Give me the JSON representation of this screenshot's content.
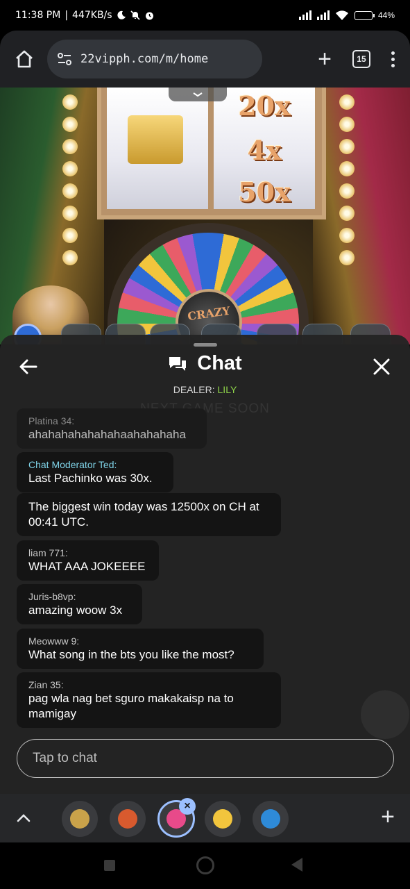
{
  "status_bar": {
    "time": "11:38 PM",
    "net_speed": "447KB/s",
    "battery": "44%",
    "battery_level": 0.44
  },
  "browser": {
    "url": "22vipph.com/m/home",
    "tab_count": "15"
  },
  "game": {
    "multipliers": [
      "20x",
      "4x",
      "50x"
    ],
    "wheel_label": "CRAZY"
  },
  "chat": {
    "title": "Chat",
    "dealer_label": "DEALER:",
    "dealer_name": "LILY",
    "background_notice": "NEXT GAME SOON",
    "messages": [
      {
        "author": "Platina 34:",
        "text": "ahahahahahahahaahahahaha",
        "partial": true
      },
      {
        "author": "Chat Moderator Ted:",
        "text": "Last Pachinko was 30x.",
        "moderator": true
      },
      {
        "author": "",
        "text": "The biggest win today was 12500x on CH at 00:41 UTC."
      },
      {
        "author": "liam 771:",
        "text": "WHAT AAA JOKEEEE"
      },
      {
        "author": "Juris-b8vp:",
        "text": "amazing woow 3x"
      },
      {
        "author": "Meowww 9:",
        "text": "What song in the bts you like the most?"
      },
      {
        "author": "Zian 35:",
        "text": "pag wla nag bet sguro makakaisp na to mamigay"
      }
    ],
    "input_placeholder": "Tap to chat"
  },
  "colors": {
    "dealer_name": "#8fd44a",
    "moderator": "#7fd3e8",
    "panel_bg": "#242424",
    "bubble_bg": "#141414",
    "active_tab_ring": "#9cc0ff"
  },
  "tab_dock": {
    "tabs": [
      {
        "name": "tab-crown-casino",
        "color": "#c9a24a"
      },
      {
        "name": "tab-monopoly",
        "color": "#d85a2e"
      },
      {
        "name": "tab-crazy-time",
        "color": "#e84a8a",
        "active": true
      },
      {
        "name": "tab-xo-game",
        "color": "#f2c53d"
      },
      {
        "name": "tab-blue-game",
        "color": "#2e8ad8"
      }
    ]
  }
}
